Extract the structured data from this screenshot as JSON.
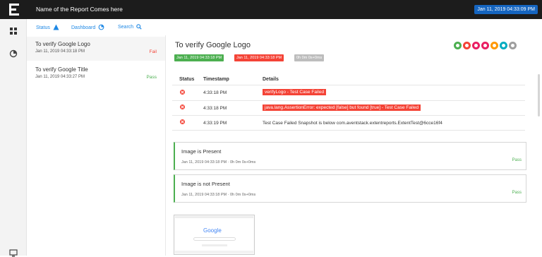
{
  "header": {
    "report_title": "Name of the Report Comes here",
    "date_badge": "Jan 11, 2019 04:33:09 PM"
  },
  "subnav": {
    "status_label": "Status",
    "dashboard_label": "Dashboard",
    "search_label": "Search"
  },
  "tests": [
    {
      "name": "To verify Google Logo",
      "time": "Jan 11, 2019 04:33:18 PM",
      "status": "Fail"
    },
    {
      "name": "To verify Google Title",
      "time": "Jan 11, 2019 04:33:27 PM",
      "status": "Pass"
    }
  ],
  "detail": {
    "title": "To verify Google Logo",
    "start_time": "Jan 11, 2019 04:33:18 PM",
    "end_time": "Jan 11, 2019 04:33:18 PM",
    "duration": "0h 0m 0s+0ms",
    "status_dot_colors": [
      "#4caf50",
      "#f44336",
      "#e91e63",
      "#e91e63",
      "#ff9800",
      "#00acc1",
      "#9e9e9e"
    ],
    "log_headers": {
      "status": "Status",
      "timestamp": "Timestamp",
      "details": "Details"
    },
    "logs": [
      {
        "time": "4:33:18 PM",
        "details": "verifyLogo - Test Case Failed"
      },
      {
        "time": "4:33:18 PM",
        "details": "java.lang.AssertionError: expected [false] but found [true] - Test Case Failed"
      },
      {
        "time": "4:33:19 PM",
        "details": "Test Case Failed Snapshot is below com.aventstack.extentreports.ExtentTest@6cce16f4"
      }
    ],
    "nodes": [
      {
        "name": "Image is Present",
        "time": "Jan 11, 2019 04:33:18 PM · 0h 0m 0s+0ms",
        "status": "Pass"
      },
      {
        "name": "Image is not Present",
        "time": "Jan 11, 2019 04:33:18 PM · 0h 0m 0s+0ms",
        "status": "Pass"
      }
    ],
    "screenshot_logo": "Google"
  },
  "colors": {
    "fail": "#f44336",
    "pass": "#4caf50",
    "topbar": "#1c1c1c",
    "accent": "#1e88e5"
  }
}
